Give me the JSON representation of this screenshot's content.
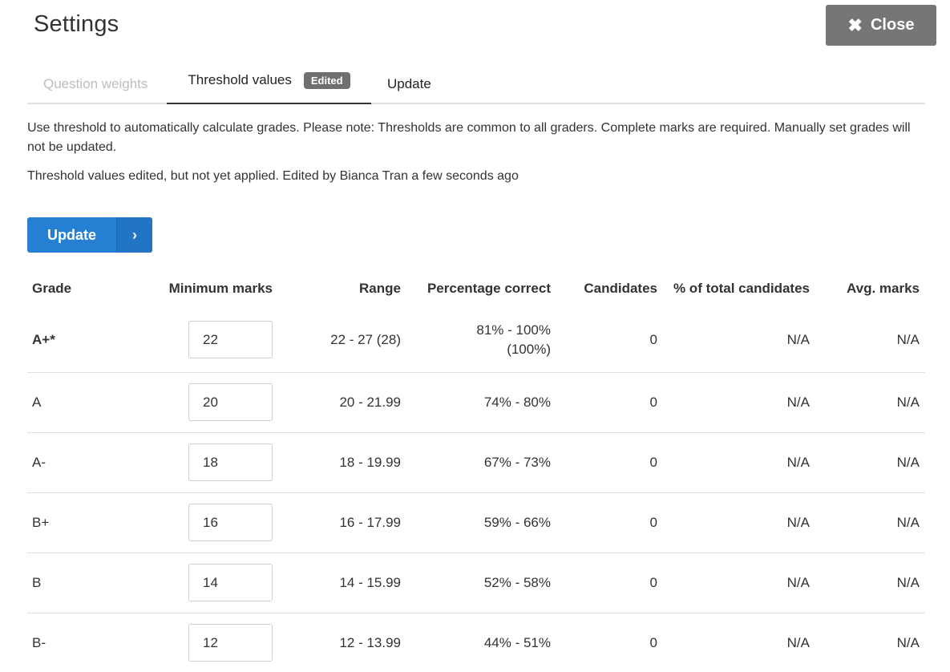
{
  "header": {
    "title": "Settings",
    "close_label": "Close"
  },
  "tabs": [
    {
      "label": "Question weights",
      "state": "disabled"
    },
    {
      "label": "Threshold values",
      "state": "active",
      "badge": "Edited"
    },
    {
      "label": "Update",
      "state": "normal"
    }
  ],
  "notes": {
    "info": "Use threshold to automatically calculate grades. Please note: Thresholds are common to all graders. Complete marks are required. Manually set grades will not be updated.",
    "status": "Threshold values edited, but not yet applied. Edited by Bianca Tran a few seconds ago"
  },
  "update_button": {
    "label": "Update",
    "arrow": "›"
  },
  "table": {
    "headers": {
      "grade": "Grade",
      "min_marks": "Minimum marks",
      "range": "Range",
      "pct": "Percentage correct",
      "candidates": "Candidates",
      "pct_total": "% of total candidates",
      "avg": "Avg. marks"
    },
    "rows": [
      {
        "grade": "A+*",
        "min": "22",
        "range": "22 - 27 (28)",
        "pct_line1": "81% - 100%",
        "pct_line2": "(100%)",
        "candidates": "0",
        "pct_total": "N/A",
        "avg": "N/A"
      },
      {
        "grade": "A",
        "min": "20",
        "range": "20 - 21.99",
        "pct_line1": "74% - 80%",
        "pct_line2": "",
        "candidates": "0",
        "pct_total": "N/A",
        "avg": "N/A"
      },
      {
        "grade": "A-",
        "min": "18",
        "range": "18 - 19.99",
        "pct_line1": "67% - 73%",
        "pct_line2": "",
        "candidates": "0",
        "pct_total": "N/A",
        "avg": "N/A"
      },
      {
        "grade": "B+",
        "min": "16",
        "range": "16 - 17.99",
        "pct_line1": "59% - 66%",
        "pct_line2": "",
        "candidates": "0",
        "pct_total": "N/A",
        "avg": "N/A"
      },
      {
        "grade": "B",
        "min": "14",
        "range": "14 - 15.99",
        "pct_line1": "52% - 58%",
        "pct_line2": "",
        "candidates": "0",
        "pct_total": "N/A",
        "avg": "N/A"
      },
      {
        "grade": "B-",
        "min": "12",
        "range": "12 - 13.99",
        "pct_line1": "44% - 51%",
        "pct_line2": "",
        "candidates": "0",
        "pct_total": "N/A",
        "avg": "N/A"
      }
    ]
  },
  "colors": {
    "primary": "#2580d3",
    "close_bg": "#767676",
    "badge_bg": "#6f6f6f",
    "disabled_tab": "#bdbdbd"
  }
}
